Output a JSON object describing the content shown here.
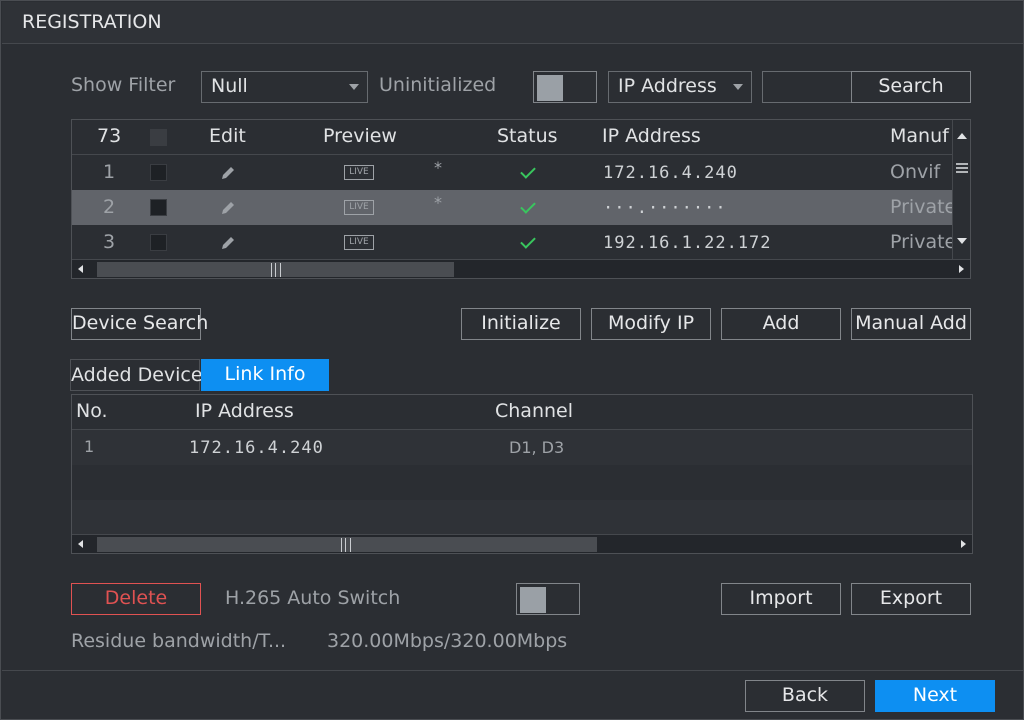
{
  "window": {
    "title": "REGISTRATION"
  },
  "filter": {
    "show_filter_label": "Show Filter",
    "show_filter_value": "Null",
    "uninitialized_label": "Uninitialized",
    "search_type_value": "IP Address",
    "search_input_value": "",
    "search_button": "Search"
  },
  "device_table": {
    "headers": {
      "count": "73",
      "edit": "Edit",
      "preview": "Preview",
      "status": "Status",
      "ip": "IP Address",
      "manufacturer": "Manuf"
    },
    "rows": [
      {
        "no": "1",
        "live": "LIVE",
        "star": "*",
        "ip": "172.16.4.240",
        "manufacturer": "Onvif"
      },
      {
        "no": "2",
        "live": "LIVE",
        "star": "*",
        "ip": "···.·······",
        "manufacturer": "Private"
      },
      {
        "no": "3",
        "live": "LIVE",
        "star": "",
        "ip": "192.16.1.22.172",
        "manufacturer": "Private"
      }
    ]
  },
  "actions": {
    "device_search": "Device Search",
    "initialize": "Initialize",
    "modify_ip": "Modify IP",
    "add": "Add",
    "manual_add": "Manual Add"
  },
  "tabs": {
    "added_device": "Added Device",
    "link_info": "Link Info"
  },
  "link_table": {
    "headers": {
      "no": "No.",
      "ip": "IP Address",
      "channel": "Channel"
    },
    "rows": [
      {
        "no": "1",
        "ip": "172.16.4.240",
        "channel": "D1, D3"
      }
    ]
  },
  "bottom": {
    "delete": "Delete",
    "h265_label": "H.265 Auto Switch",
    "import": "Import",
    "export": "Export",
    "bandwidth_label": "Residue bandwidth/T...",
    "bandwidth_value": "320.00Mbps/320.00Mbps"
  },
  "footer": {
    "back": "Back",
    "next": "Next"
  },
  "colors": {
    "accent": "#0d8ff2",
    "danger": "#e05252",
    "ok": "#39c65e"
  }
}
